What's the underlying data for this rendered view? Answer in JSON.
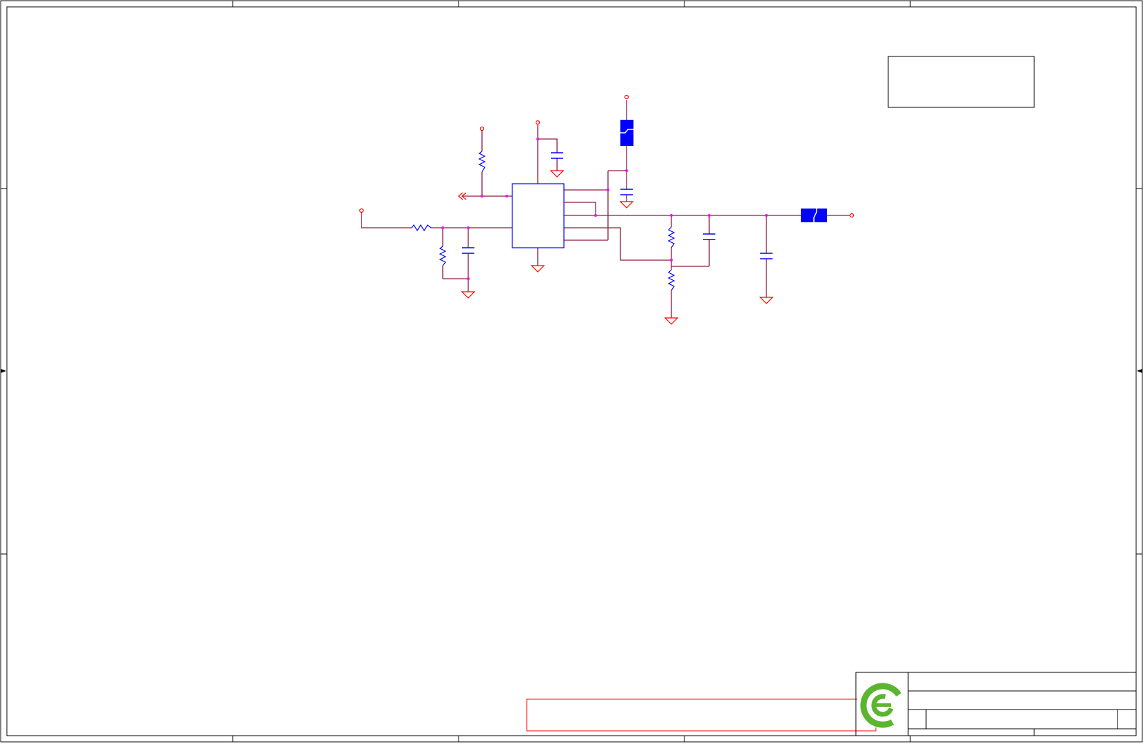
{
  "colors": {
    "border": "#000000",
    "wire": "#8b1a3a",
    "power": "#ff0000",
    "junction": "#ff00ff",
    "component": "#0000ff",
    "component_fill": "#0000ff",
    "note_box": "#ff0000",
    "logo": "#5cb531"
  },
  "icons": {
    "logo": "company-logo-icon",
    "ground": "ground-icon",
    "power_port": "power-port-icon",
    "offpage": "off-page-connector-icon"
  },
  "title_block": {
    "title": "",
    "sheet": "",
    "rev": ""
  }
}
